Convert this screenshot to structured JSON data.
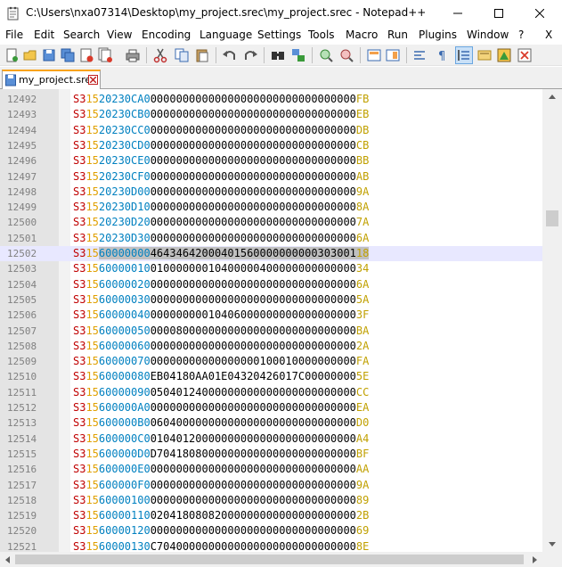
{
  "window": {
    "title": "C:\\Users\\nxa07314\\Desktop\\my_project.srec\\my_project.srec - Notepad++",
    "icon": "notepadpp-icon"
  },
  "menu": {
    "items": [
      "File",
      "Edit",
      "Search",
      "View",
      "Encoding",
      "Language",
      "Settings",
      "Tools",
      "Macro",
      "Run",
      "Plugins",
      "Window",
      "?"
    ],
    "close_x": "X"
  },
  "toolbar": {
    "buttons": [
      "new-file-icon",
      "open-file-icon",
      "save-icon",
      "save-all-icon",
      "close-icon",
      "close-all-icon",
      "print-icon",
      "cut-icon",
      "copy-icon",
      "paste-icon",
      "undo-icon",
      "redo-icon",
      "find-icon",
      "replace-icon",
      "zoom-in-icon",
      "zoom-out-icon",
      "sync-vertical-icon",
      "sync-horizontal-icon",
      "word-wrap-icon",
      "show-all-chars-icon",
      "indent-guide-icon",
      "user-language-icon",
      "document-map-icon",
      "function-list-icon",
      "folder-workspace-icon",
      "record-macro-icon"
    ],
    "active_button": "indent-guide-icon"
  },
  "tab": {
    "label": "my_project.srec",
    "close_icon": "tab-close-icon"
  },
  "colors": {
    "record_type": "#c00000",
    "byte_count": "#e0a000",
    "address": "#0080c0",
    "data": "#000000",
    "checksum": "#c0a000",
    "current_line": "#e8e8ff",
    "tab_accent": "#f9a31a"
  },
  "editor": {
    "current_line_index": 10,
    "lines": [
      {
        "num": "12492",
        "type": "S3",
        "len": "15",
        "addr": "20230CA0",
        "data": "00000000000000000000000000000000",
        "sum": "FB"
      },
      {
        "num": "12493",
        "type": "S3",
        "len": "15",
        "addr": "20230CB0",
        "data": "00000000000000000000000000000000",
        "sum": "EB"
      },
      {
        "num": "12494",
        "type": "S3",
        "len": "15",
        "addr": "20230CC0",
        "data": "00000000000000000000000000000000",
        "sum": "DB"
      },
      {
        "num": "12495",
        "type": "S3",
        "len": "15",
        "addr": "20230CD0",
        "data": "00000000000000000000000000000000",
        "sum": "CB"
      },
      {
        "num": "12496",
        "type": "S3",
        "len": "15",
        "addr": "20230CE0",
        "data": "00000000000000000000000000000000",
        "sum": "BB"
      },
      {
        "num": "12497",
        "type": "S3",
        "len": "15",
        "addr": "20230CF0",
        "data": "00000000000000000000000000000000",
        "sum": "AB"
      },
      {
        "num": "12498",
        "type": "S3",
        "len": "15",
        "addr": "20230D00",
        "data": "00000000000000000000000000000000",
        "sum": "9A"
      },
      {
        "num": "12499",
        "type": "S3",
        "len": "15",
        "addr": "20230D10",
        "data": "00000000000000000000000000000000",
        "sum": "8A"
      },
      {
        "num": "12500",
        "type": "S3",
        "len": "15",
        "addr": "20230D20",
        "data": "00000000000000000000000000000000",
        "sum": "7A"
      },
      {
        "num": "12501",
        "type": "S3",
        "len": "15",
        "addr": "20230D30",
        "data": "00000000000000000000000000000000",
        "sum": "6A"
      },
      {
        "num": "12502",
        "type": "S3",
        "len": "15",
        "addr": "60000000",
        "data": "46434642000401560000000000303001",
        "sum": "18"
      },
      {
        "num": "12503",
        "type": "S3",
        "len": "15",
        "addr": "60000010",
        "data": "01000000010400000400000000000000",
        "sum": "34"
      },
      {
        "num": "12504",
        "type": "S3",
        "len": "15",
        "addr": "60000020",
        "data": "00000000000000000000000000000000",
        "sum": "6A"
      },
      {
        "num": "12505",
        "type": "S3",
        "len": "15",
        "addr": "60000030",
        "data": "00000000000000000000000000000000",
        "sum": "5A"
      },
      {
        "num": "12506",
        "type": "S3",
        "len": "15",
        "addr": "60000040",
        "data": "00000000010406000000000000000000",
        "sum": "3F"
      },
      {
        "num": "12507",
        "type": "S3",
        "len": "15",
        "addr": "60000050",
        "data": "00008000000000000000000000000000",
        "sum": "BA"
      },
      {
        "num": "12508",
        "type": "S3",
        "len": "15",
        "addr": "60000060",
        "data": "00000000000000000000000000000000",
        "sum": "2A"
      },
      {
        "num": "12509",
        "type": "S3",
        "len": "15",
        "addr": "60000070",
        "data": "00000000000000000100010000000000",
        "sum": "FA"
      },
      {
        "num": "12510",
        "type": "S3",
        "len": "15",
        "addr": "60000080",
        "data": "EB04180AA01E04320426017C00000000",
        "sum": "5E"
      },
      {
        "num": "12511",
        "type": "S3",
        "len": "15",
        "addr": "60000090",
        "data": "05040124000000000000000000000000",
        "sum": "CC"
      },
      {
        "num": "12512",
        "type": "S3",
        "len": "15",
        "addr": "600000A0",
        "data": "00000000000000000000000000000000",
        "sum": "EA"
      },
      {
        "num": "12513",
        "type": "S3",
        "len": "15",
        "addr": "600000B0",
        "data": "06040000000000000000000000000000",
        "sum": "D0"
      },
      {
        "num": "12514",
        "type": "S3",
        "len": "15",
        "addr": "600000C0",
        "data": "01040120000000000000000000000000",
        "sum": "A4"
      },
      {
        "num": "12515",
        "type": "S3",
        "len": "15",
        "addr": "600000D0",
        "data": "D7041808000000000000000000000000",
        "sum": "BF"
      },
      {
        "num": "12516",
        "type": "S3",
        "len": "15",
        "addr": "600000E0",
        "data": "00000000000000000000000000000000",
        "sum": "AA"
      },
      {
        "num": "12517",
        "type": "S3",
        "len": "15",
        "addr": "600000F0",
        "data": "00000000000000000000000000000000",
        "sum": "9A"
      },
      {
        "num": "12518",
        "type": "S3",
        "len": "15",
        "addr": "60000100",
        "data": "00000000000000000000000000000000",
        "sum": "89"
      },
      {
        "num": "12519",
        "type": "S3",
        "len": "15",
        "addr": "60000110",
        "data": "02041808082000000000000000000000",
        "sum": "2B"
      },
      {
        "num": "12520",
        "type": "S3",
        "len": "15",
        "addr": "60000120",
        "data": "00000000000000000000000000000000",
        "sum": "69"
      },
      {
        "num": "12521",
        "type": "S3",
        "len": "15",
        "addr": "60000130",
        "data": "C7040000000000000000000000000000",
        "sum": "8E"
      }
    ]
  }
}
